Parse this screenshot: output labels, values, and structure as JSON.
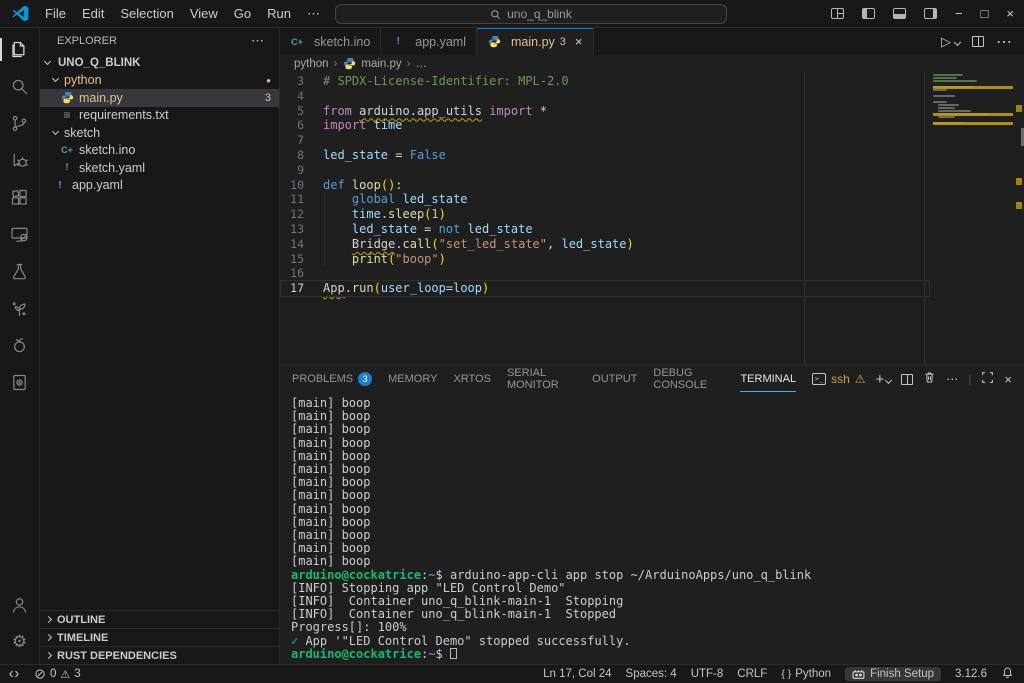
{
  "colors": {
    "accent": "#0078d4",
    "modified_gold": "#e2c08d",
    "warning_yellow": "#c9a13b",
    "terminal_green": "#0dbc79"
  },
  "title_bar": {
    "menus": [
      "File",
      "Edit",
      "Selection",
      "View",
      "Go",
      "Run",
      "⋯"
    ],
    "back_arrow": "←",
    "forward_arrow": "→",
    "search_value": "uno_q_blink",
    "min_glyph": "−",
    "max_glyph": "□",
    "close_glyph": "×"
  },
  "activity_bar": {
    "top": [
      {
        "icon": "files-icon",
        "active": true
      },
      {
        "icon": "search-icon"
      },
      {
        "icon": "source-control-icon"
      },
      {
        "icon": "run-debug-icon"
      },
      {
        "icon": "extensions-icon"
      },
      {
        "icon": "remote-explorer-icon"
      },
      {
        "icon": "test-beaker-icon"
      },
      {
        "icon": "sprout-icon"
      },
      {
        "icon": "berry-icon"
      },
      {
        "icon": "notebook-icon"
      }
    ],
    "bottom": [
      {
        "icon": "account-icon"
      },
      {
        "icon": "settings-gear-icon"
      }
    ]
  },
  "explorer": {
    "title": "EXPLORER",
    "more_glyph": "⋯",
    "tree": [
      {
        "label": "UNO_Q_BLINK",
        "kind": "root",
        "expanded": true,
        "indent": 0,
        "bold": true
      },
      {
        "label": "python",
        "kind": "folder",
        "expanded": true,
        "indent": 1,
        "gold": true,
        "badge": "●"
      },
      {
        "label": "main.py",
        "kind": "file",
        "icon": "python-icon",
        "indent": 2,
        "selected": true,
        "gold": true,
        "badge": "3"
      },
      {
        "label": "requirements.txt",
        "kind": "file",
        "icon": "text-file-icon",
        "indent": 2
      },
      {
        "label": "sketch",
        "kind": "folder",
        "expanded": true,
        "indent": 1
      },
      {
        "label": "sketch.ino",
        "kind": "file",
        "icon": "ino-file-icon",
        "indent": 2
      },
      {
        "label": "sketch.yaml",
        "kind": "file",
        "icon": "yaml-file-icon",
        "indent": 2
      },
      {
        "label": "app.yaml",
        "kind": "file",
        "icon": "yaml-file-icon",
        "indent": 1
      }
    ],
    "sections": [
      "OUTLINE",
      "TIMELINE",
      "RUST DEPENDENCIES"
    ]
  },
  "tabs": [
    {
      "label": "sketch.ino",
      "icon": "ino-file-icon"
    },
    {
      "label": "app.yaml",
      "icon": "yaml-file-icon"
    },
    {
      "label": "main.py",
      "icon": "python-icon",
      "active": true,
      "badge": "3",
      "close": "×"
    }
  ],
  "tab_actions": {
    "run_glyph": "▷",
    "more_glyph": "⋯"
  },
  "breadcrumb": [
    {
      "label": "python"
    },
    {
      "label": "main.py",
      "icon": "python-icon"
    },
    {
      "label": "…"
    }
  ],
  "editor": {
    "lines": [
      {
        "n": 3,
        "tokens": [
          [
            "# SPDX-License-Identifier: MPL-2.0",
            "cmt"
          ]
        ]
      },
      {
        "n": 4,
        "tokens": []
      },
      {
        "n": 5,
        "tokens": [
          [
            "from",
            "kw"
          ],
          [
            " ",
            "pl"
          ],
          [
            "arduino.app_utils",
            "pl sq"
          ],
          [
            " ",
            "pl"
          ],
          [
            "import",
            "kw"
          ],
          [
            " *",
            "pl"
          ]
        ]
      },
      {
        "n": 6,
        "tokens": [
          [
            "import",
            "kw"
          ],
          [
            " ",
            "pl"
          ],
          [
            "time",
            "ty vr"
          ]
        ]
      },
      {
        "n": 7,
        "tokens": []
      },
      {
        "n": 8,
        "tokens": [
          [
            "led_state",
            "vr"
          ],
          [
            " = ",
            "pl"
          ],
          [
            "False",
            "kb"
          ]
        ]
      },
      {
        "n": 9,
        "tokens": []
      },
      {
        "n": 10,
        "tokens": [
          [
            "def",
            "kb"
          ],
          [
            " ",
            "pl"
          ],
          [
            "loop",
            "fn"
          ],
          [
            "(",
            "br"
          ],
          [
            ")",
            "br"
          ],
          [
            ":",
            "pl"
          ]
        ]
      },
      {
        "n": 11,
        "tokens": [
          [
            "    ",
            "pl"
          ],
          [
            "global",
            "kb"
          ],
          [
            " ",
            "pl"
          ],
          [
            "led_state",
            "vr"
          ]
        ]
      },
      {
        "n": 12,
        "tokens": [
          [
            "    ",
            "pl"
          ],
          [
            "time",
            "vr"
          ],
          [
            ".",
            "pl"
          ],
          [
            "sleep",
            "fn"
          ],
          [
            "(",
            "br"
          ],
          [
            "1",
            "nm"
          ],
          [
            ")",
            "br"
          ]
        ]
      },
      {
        "n": 13,
        "tokens": [
          [
            "    ",
            "pl"
          ],
          [
            "led_state",
            "vr"
          ],
          [
            " = ",
            "pl"
          ],
          [
            "not",
            "kb"
          ],
          [
            " ",
            "pl"
          ],
          [
            "led_state",
            "vr"
          ]
        ]
      },
      {
        "n": 14,
        "tokens": [
          [
            "    ",
            "pl"
          ],
          [
            "Bridge",
            "pl sq"
          ],
          [
            ".",
            "pl"
          ],
          [
            "call",
            "fn"
          ],
          [
            "(",
            "br"
          ],
          [
            "\"set_led_state\"",
            "st"
          ],
          [
            ", ",
            "pl"
          ],
          [
            "led_state",
            "vr"
          ],
          [
            ")",
            "br"
          ]
        ]
      },
      {
        "n": 15,
        "tokens": [
          [
            "    ",
            "pl"
          ],
          [
            "print",
            "fn"
          ],
          [
            "(",
            "br"
          ],
          [
            "\"boop\"",
            "st"
          ],
          [
            ")",
            "br"
          ]
        ]
      },
      {
        "n": 16,
        "tokens": []
      },
      {
        "n": 17,
        "current": true,
        "tokens": [
          [
            "App",
            "pl sq"
          ],
          [
            ".",
            "pl"
          ],
          [
            "run",
            "fn"
          ],
          [
            "(",
            "br"
          ],
          [
            "user_loop",
            "vr"
          ],
          [
            "=",
            "pl"
          ],
          [
            "loop",
            "vr"
          ],
          [
            ")",
            "br"
          ]
        ]
      }
    ],
    "minimap_extra_top_lines": 2,
    "warn_lines": [
      5,
      14,
      17
    ]
  },
  "panel": {
    "tabs": [
      {
        "label": "PROBLEMS",
        "badge": "3"
      },
      {
        "label": "MEMORY"
      },
      {
        "label": "XRTOS"
      },
      {
        "label": "SERIAL MONITOR"
      },
      {
        "label": "OUTPUT"
      },
      {
        "label": "DEBUG CONSOLE"
      },
      {
        "label": "TERMINAL",
        "active": true
      }
    ],
    "actions": {
      "ssh_label": "ssh",
      "warn_glyph": "⚠",
      "plus_glyph": "+",
      "more_glyph": "⋯",
      "sep_glyph": "|",
      "close_glyph": "×"
    }
  },
  "terminal": {
    "lines": [
      {
        "repeat": 13,
        "tokens": [
          [
            "[main] boop",
            ""
          ]
        ]
      },
      {
        "tokens": [
          [
            "arduino@cockatrice",
            "tg"
          ],
          [
            ":",
            ""
          ],
          [
            "~",
            "tb"
          ],
          [
            "$ ",
            ""
          ],
          [
            "arduino-app-cli app stop ~/ArduinoApps/uno_q_blink",
            ""
          ]
        ]
      },
      {
        "tokens": [
          [
            "[INFO] Stopping app \"LED Control Demo\"",
            ""
          ]
        ]
      },
      {
        "tokens": [
          [
            "[INFO]  Container uno_q_blink-main-1  Stopping",
            ""
          ]
        ]
      },
      {
        "tokens": [
          [
            "[INFO]  Container uno_q_blink-main-1  Stopped",
            ""
          ]
        ]
      },
      {
        "tokens": [
          [
            "Progress[]: 100%",
            ""
          ]
        ]
      },
      {
        "tokens": [
          [
            "✓",
            "tg"
          ],
          [
            " App '\"LED Control Demo\" stopped successfully.",
            ""
          ]
        ]
      },
      {
        "tokens": [
          [
            "arduino@cockatrice",
            "tg"
          ],
          [
            ":",
            ""
          ],
          [
            "~",
            "tb"
          ],
          [
            "$ ",
            ""
          ],
          [
            "",
            "cursor"
          ]
        ]
      }
    ]
  },
  "status_bar": {
    "errors": "0",
    "warnings": "3",
    "cursor_position": "Ln 17, Col 24",
    "indentation": "Spaces: 4",
    "encoding": "UTF-8",
    "eol": "CRLF",
    "language_glyph": "{ }",
    "language": "Python",
    "setup_label": "Finish Setup",
    "interpreter_version": "3.12.6"
  }
}
